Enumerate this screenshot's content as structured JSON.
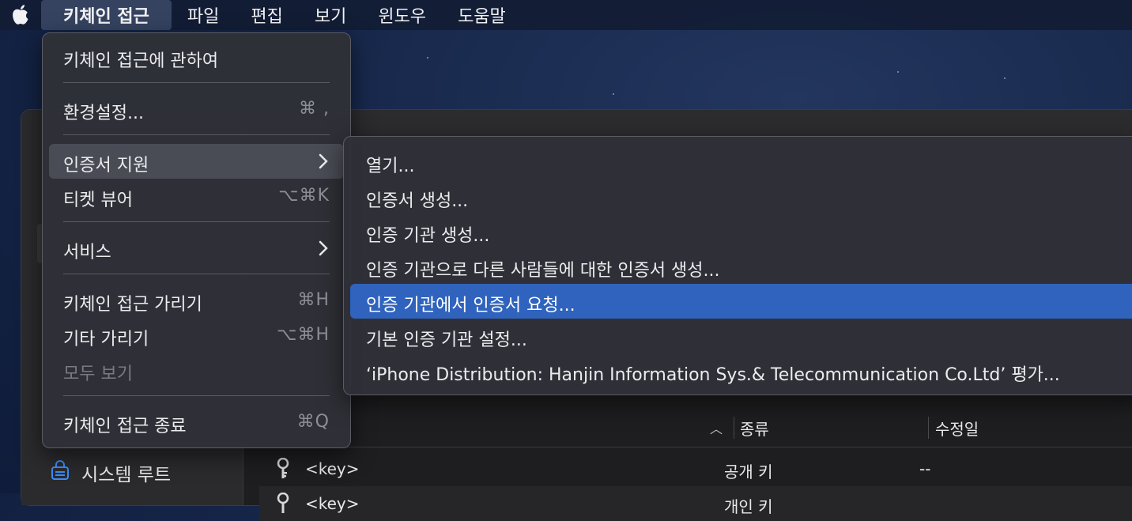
{
  "menubar": {
    "apple_icon": "apple-logo-icon",
    "items": [
      "키체인 접근",
      "파일",
      "편집",
      "보기",
      "윈도우",
      "도움말"
    ]
  },
  "main_menu": {
    "about": "키체인 접근에 관하여",
    "preferences": "환경설정...",
    "preferences_shortcut": "⌘ ,",
    "cert_assistant": "인증서 지원",
    "ticket_viewer": "티켓 뷰어",
    "ticket_viewer_shortcut": "⌥⌘K",
    "services": "서비스",
    "hide": "키체인 접근 가리기",
    "hide_shortcut": "⌘H",
    "hide_others": "기타 가리기",
    "hide_others_shortcut": "⌥⌘H",
    "show_all": "모두 보기",
    "quit": "키체인 접근 종료",
    "quit_shortcut": "⌘Q"
  },
  "sub_menu": {
    "items": [
      "열기...",
      "인증서 생성...",
      "인증 기관 생성...",
      "인증 기관으로 다른 사람들에 대한 인증서 생성...",
      "인증 기관에서 인증서 요청...",
      "기본 인증 기관 설정...",
      "‘iPhone Distribution: Hanjin Information Sys.& Telecommunication Co.Ltd’ 평가..."
    ],
    "selected_index": 4
  },
  "window": {
    "sidebar": {
      "system_root": "시스템 루트"
    },
    "table": {
      "columns": {
        "kind": "종류",
        "modified": "수정일"
      },
      "rows": [
        {
          "name": "<key>",
          "kind": "공개 키",
          "modified": "--"
        },
        {
          "name": "<key>",
          "kind": "개인 키",
          "modified": ""
        }
      ]
    }
  },
  "colors": {
    "accent": "#2f63bd",
    "menu_bg": "#303138",
    "desktop": "#162649"
  }
}
